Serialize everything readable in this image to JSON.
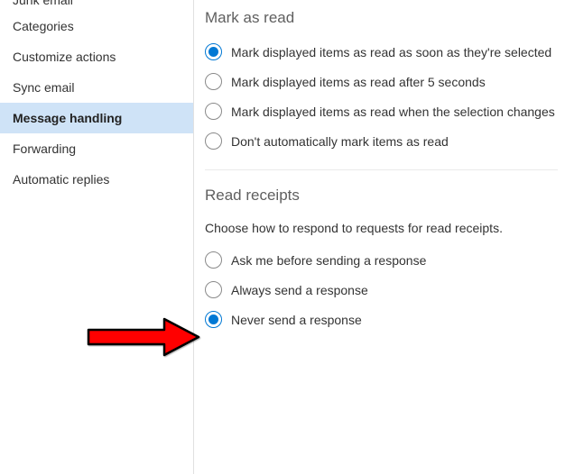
{
  "sidebar": {
    "items": [
      {
        "label": "Junk email",
        "active": false,
        "cut": true
      },
      {
        "label": "Categories",
        "active": false
      },
      {
        "label": "Customize actions",
        "active": false
      },
      {
        "label": "Sync email",
        "active": false
      },
      {
        "label": "Message handling",
        "active": true
      },
      {
        "label": "Forwarding",
        "active": false
      },
      {
        "label": "Automatic replies",
        "active": false
      }
    ]
  },
  "main": {
    "mark_as_read": {
      "title": "Mark as read",
      "options": [
        {
          "label": "Mark displayed items as read as soon as they're selected",
          "selected": true
        },
        {
          "label": "Mark displayed items as read after 5 seconds",
          "selected": false
        },
        {
          "label": "Mark displayed items as read when the selection changes",
          "selected": false
        },
        {
          "label": "Don't automatically mark items as read",
          "selected": false
        }
      ]
    },
    "read_receipts": {
      "title": "Read receipts",
      "helper": "Choose how to respond to requests for read receipts.",
      "options": [
        {
          "label": "Ask me before sending a response",
          "selected": false
        },
        {
          "label": "Always send a response",
          "selected": false
        },
        {
          "label": "Never send a response",
          "selected": true
        }
      ]
    }
  }
}
